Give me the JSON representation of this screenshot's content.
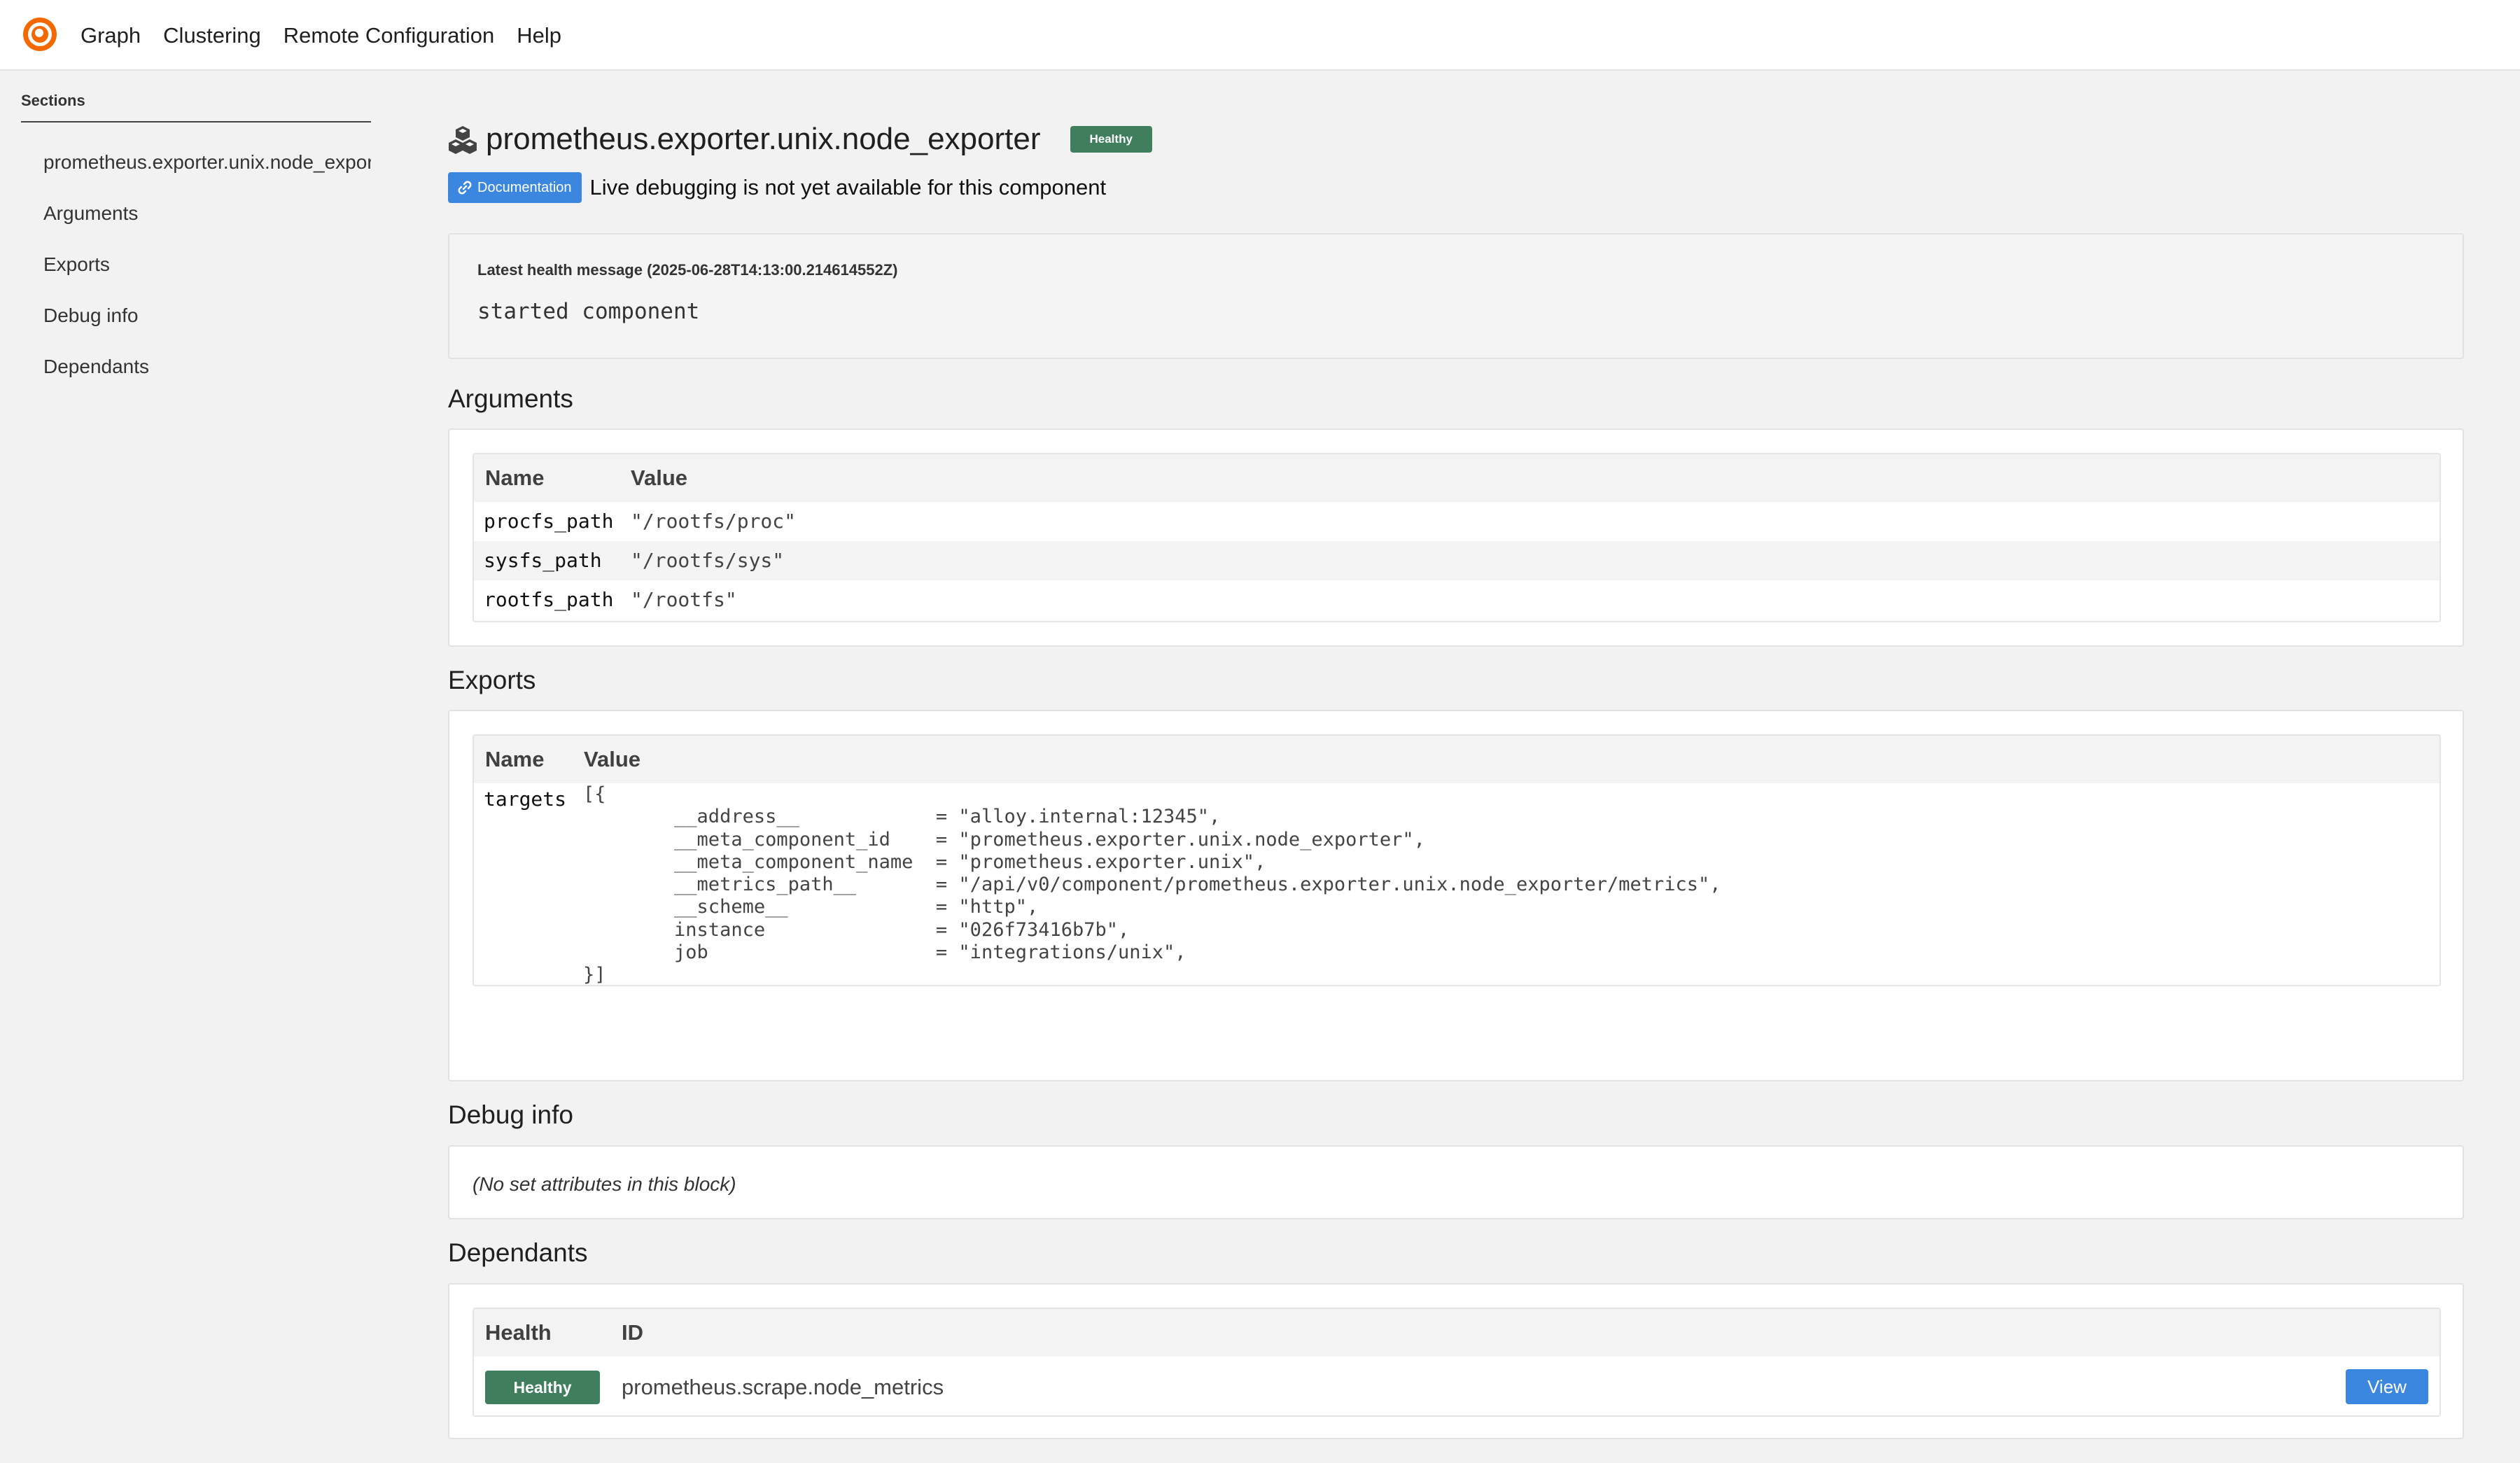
{
  "nav": {
    "items": [
      "Graph",
      "Clustering",
      "Remote Configuration",
      "Help"
    ]
  },
  "sidebar": {
    "title": "Sections",
    "items": [
      "prometheus.exporter.unix.node_exporter",
      "Arguments",
      "Exports",
      "Debug info",
      "Dependants"
    ]
  },
  "header": {
    "title": "prometheus.exporter.unix.node_exporter",
    "health_badge": "Healthy",
    "doc_button": "Documentation",
    "live_note": "Live debugging is not yet available for this component"
  },
  "health": {
    "label": "Latest health message (2025-06-28T14:13:00.214614552Z)",
    "message": "started component"
  },
  "arguments": {
    "title": "Arguments",
    "col_name": "Name",
    "col_value": "Value",
    "rows": [
      {
        "name": "procfs_path",
        "value": "\"/rootfs/proc\""
      },
      {
        "name": "sysfs_path",
        "value": "\"/rootfs/sys\""
      },
      {
        "name": "rootfs_path",
        "value": "\"/rootfs\""
      }
    ]
  },
  "exports": {
    "title": "Exports",
    "col_name": "Name",
    "col_value": "Value",
    "name": "targets",
    "value": "[{\n        __address__            = \"alloy.internal:12345\",\n        __meta_component_id    = \"prometheus.exporter.unix.node_exporter\",\n        __meta_component_name  = \"prometheus.exporter.unix\",\n        __metrics_path__       = \"/api/v0/component/prometheus.exporter.unix.node_exporter/metrics\",\n        __scheme__             = \"http\",\n        instance               = \"026f73416b7b\",\n        job                    = \"integrations/unix\",\n}]"
  },
  "debug": {
    "title": "Debug info",
    "note": "(No set attributes in this block)"
  },
  "dependants": {
    "title": "Dependants",
    "col_health": "Health",
    "col_id": "ID",
    "rows": [
      {
        "health": "Healthy",
        "id": "prometheus.scrape.node_metrics",
        "action": "View"
      }
    ]
  },
  "colors": {
    "healthy": "#3f7f5d",
    "accent": "#3b87e0",
    "logo": "#f46800"
  }
}
